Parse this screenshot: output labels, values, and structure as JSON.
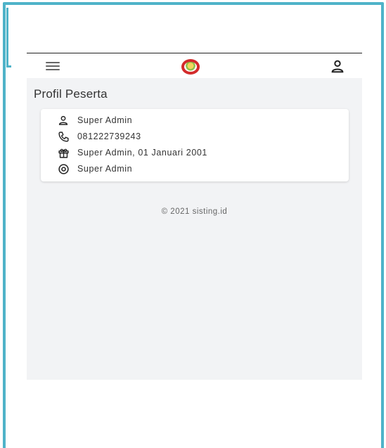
{
  "header": {
    "menu_icon": "hamburger-icon",
    "logo_icon": "app-logo",
    "user_icon": "user-icon"
  },
  "page": {
    "title": "Profil Peserta"
  },
  "profile": {
    "name": "Super Admin",
    "phone": "081222739243",
    "birth": "Super Admin, 01 Januari 2001",
    "role": "Super Admin",
    "icons": [
      "user-icon",
      "phone-icon",
      "gift-icon",
      "eye-icon"
    ]
  },
  "footer": {
    "text": "© 2021 sisting.id"
  },
  "colors": {
    "frame": "#4fb3c9",
    "background": "#f2f3f5",
    "logo": "#d32b2b"
  }
}
